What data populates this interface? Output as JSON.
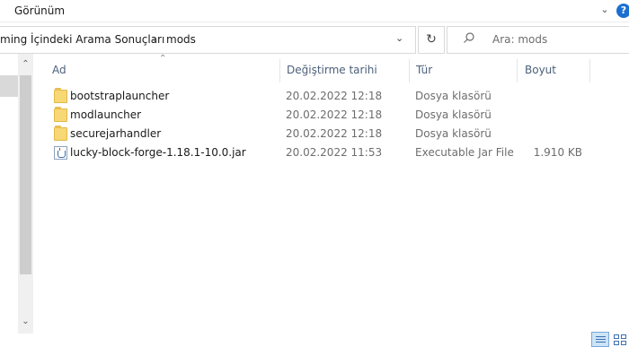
{
  "ribbon": {
    "menu_label": "Görünüm",
    "help_label": "?"
  },
  "address": {
    "crumb_parent": "ming İçindeki Arama Sonuçları",
    "separator": "›",
    "crumb_current": "mods"
  },
  "search": {
    "placeholder": "Ara: mods"
  },
  "columns": {
    "name": "Ad",
    "date": "Değiştirme tarihi",
    "type": "Tür",
    "size": "Boyut"
  },
  "files": [
    {
      "name": "bootstraplauncher",
      "date": "20.02.2022 12:18",
      "type": "Dosya klasörü",
      "size": "",
      "icon": "folder-icon"
    },
    {
      "name": "modlauncher",
      "date": "20.02.2022 12:18",
      "type": "Dosya klasörü",
      "size": "",
      "icon": "folder-icon"
    },
    {
      "name": "securejarhandler",
      "date": "20.02.2022 12:18",
      "type": "Dosya klasörü",
      "size": "",
      "icon": "folder-icon"
    },
    {
      "name": "lucky-block-forge-1.18.1-10.0.jar",
      "date": "20.02.2022 11:53",
      "type": "Executable Jar File",
      "size": "1.910 KB",
      "icon": "jar-file-icon"
    }
  ],
  "colors": {
    "accent": "#1a6fd1",
    "header_text": "#4c607a",
    "folder": "#f8d775"
  }
}
